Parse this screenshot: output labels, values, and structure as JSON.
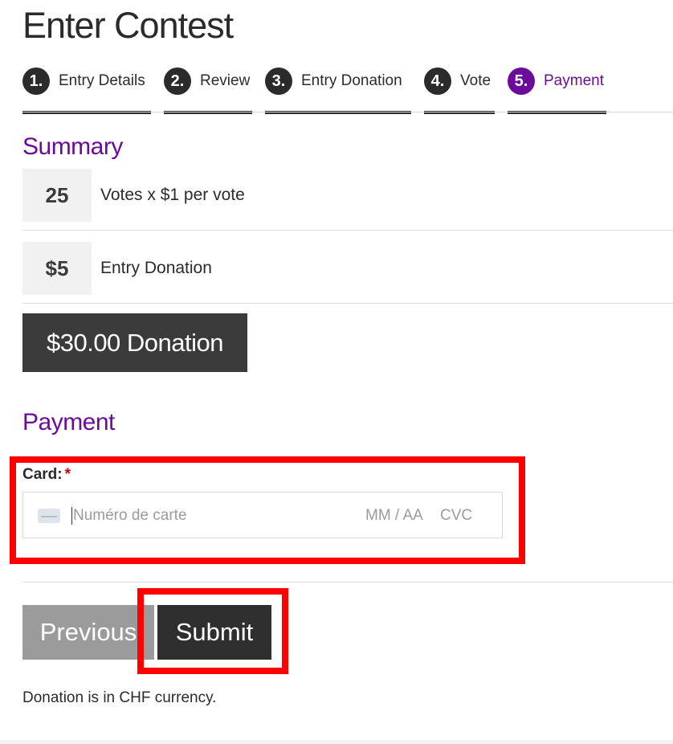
{
  "page": {
    "title": "Enter Contest"
  },
  "steps": [
    {
      "num": "1.",
      "label": "Entry Details",
      "active": false
    },
    {
      "num": "2.",
      "label": "Review",
      "active": false
    },
    {
      "num": "3.",
      "label": "Entry Donation",
      "active": false
    },
    {
      "num": "4.",
      "label": "Vote",
      "active": false
    },
    {
      "num": "5.",
      "label": "Payment",
      "active": true
    }
  ],
  "summary": {
    "heading": "Summary",
    "items": [
      {
        "qty": "25",
        "desc": "Votes x $1 per vote"
      },
      {
        "qty": "$5",
        "desc": "Entry Donation"
      }
    ],
    "total": "$30.00 Donation"
  },
  "payment": {
    "heading": "Payment",
    "card_label": "Card:",
    "required_mark": "*",
    "card_number_placeholder": "Numéro de carte",
    "expiry_placeholder": "MM / AA",
    "cvc_placeholder": "CVC"
  },
  "buttons": {
    "previous": "Previous",
    "submit": "Submit"
  },
  "note": "Donation is in CHF currency.",
  "colors": {
    "accent": "#6b0b99",
    "dark": "#2b2b2b",
    "highlight": "#ff0000",
    "muted_button": "#9b9b9b"
  }
}
